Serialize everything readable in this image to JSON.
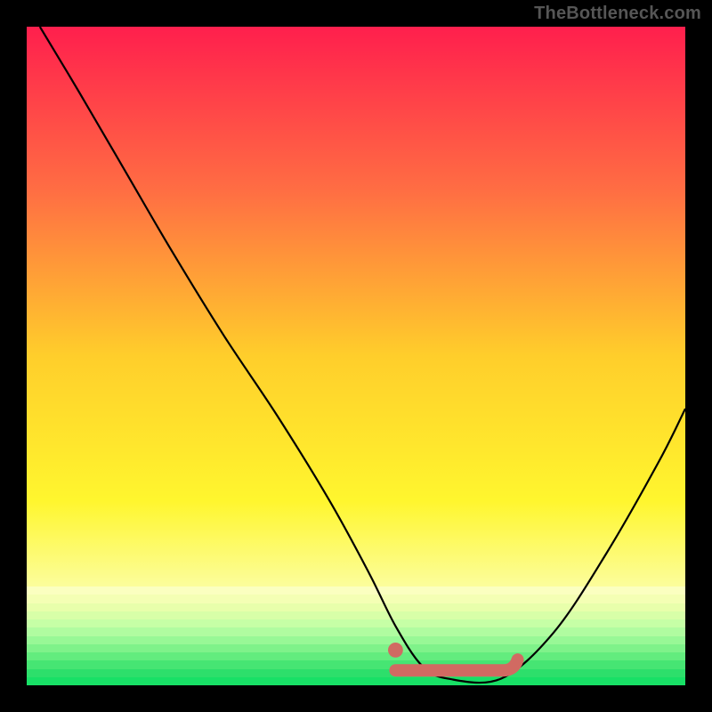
{
  "watermark": "TheBottleneck.com",
  "colors": {
    "frame": "#000000",
    "curve": "#000000",
    "marker": "#d16a62",
    "watermark": "#565656"
  },
  "chart_data": {
    "type": "line",
    "title": "",
    "xlabel": "",
    "ylabel": "",
    "xlim": [
      0,
      100
    ],
    "ylim": [
      0,
      100
    ],
    "legend": false,
    "grid": false,
    "background": {
      "type": "vertical-gradient",
      "stops": [
        {
          "pos": 0,
          "color": "#ff1f4d"
        },
        {
          "pos": 25,
          "color": "#ff6e43"
        },
        {
          "pos": 50,
          "color": "#ffce2b"
        },
        {
          "pos": 72,
          "color": "#fff62e"
        },
        {
          "pos": 88,
          "color": "#fbffb5"
        },
        {
          "pos": 93,
          "color": "#d8ffb8"
        },
        {
          "pos": 96,
          "color": "#8cf58f"
        },
        {
          "pos": 100,
          "color": "#18e06a"
        }
      ]
    },
    "series": [
      {
        "name": "bottleneck-curve",
        "x": [
          2,
          8,
          15,
          22,
          30,
          38,
          46,
          52,
          56,
          60,
          64,
          72,
          80,
          88,
          96,
          100
        ],
        "y": [
          100,
          90,
          78,
          66,
          53,
          41,
          28,
          17,
          9,
          3,
          1,
          1,
          8,
          20,
          34,
          42
        ]
      }
    ],
    "markers": [
      {
        "name": "flat-range-highlight",
        "shape": "rounded-segment",
        "color": "#d16a62",
        "x_start": 56,
        "x_end": 74,
        "y": 2
      },
      {
        "name": "left-dot",
        "shape": "circle",
        "color": "#d16a62",
        "x": 56,
        "y": 4,
        "r": 1.2
      }
    ]
  }
}
